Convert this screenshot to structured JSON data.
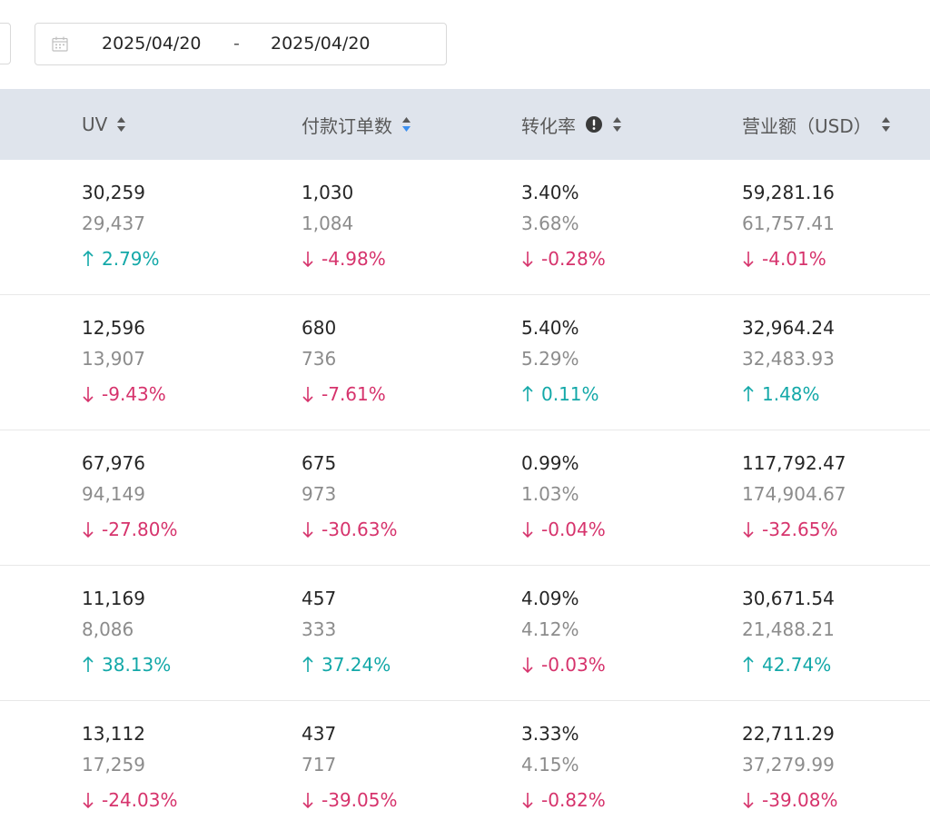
{
  "filters": {
    "date_start": "2025/04/20",
    "date_separator": "-",
    "date_end": "2025/04/20"
  },
  "columns": [
    {
      "key": "uv",
      "label": "UV",
      "sort": "none",
      "info": false
    },
    {
      "key": "orders",
      "label": "付款订单数",
      "sort": "descending",
      "info": false
    },
    {
      "key": "conversion",
      "label": "转化率",
      "sort": "none",
      "info": true
    },
    {
      "key": "revenue",
      "label": "营业额（USD）",
      "sort": "none",
      "info": false
    }
  ],
  "rows": [
    [
      {
        "current": "30,259",
        "previous": "29,437",
        "change": "2.79%",
        "direction": "up"
      },
      {
        "current": "1,030",
        "previous": "1,084",
        "change": "-4.98%",
        "direction": "down"
      },
      {
        "current": "3.40%",
        "previous": "3.68%",
        "change": "-0.28%",
        "direction": "down"
      },
      {
        "current": "59,281.16",
        "previous": "61,757.41",
        "change": "-4.01%",
        "direction": "down"
      }
    ],
    [
      {
        "current": "12,596",
        "previous": "13,907",
        "change": "-9.43%",
        "direction": "down"
      },
      {
        "current": "680",
        "previous": "736",
        "change": "-7.61%",
        "direction": "down"
      },
      {
        "current": "5.40%",
        "previous": "5.29%",
        "change": "0.11%",
        "direction": "up"
      },
      {
        "current": "32,964.24",
        "previous": "32,483.93",
        "change": "1.48%",
        "direction": "up"
      }
    ],
    [
      {
        "current": "67,976",
        "previous": "94,149",
        "change": "-27.80%",
        "direction": "down"
      },
      {
        "current": "675",
        "previous": "973",
        "change": "-30.63%",
        "direction": "down"
      },
      {
        "current": "0.99%",
        "previous": "1.03%",
        "change": "-0.04%",
        "direction": "down"
      },
      {
        "current": "117,792.47",
        "previous": "174,904.67",
        "change": "-32.65%",
        "direction": "down"
      }
    ],
    [
      {
        "current": "11,169",
        "previous": "8,086",
        "change": "38.13%",
        "direction": "up"
      },
      {
        "current": "457",
        "previous": "333",
        "change": "37.24%",
        "direction": "up"
      },
      {
        "current": "4.09%",
        "previous": "4.12%",
        "change": "-0.03%",
        "direction": "down"
      },
      {
        "current": "30,671.54",
        "previous": "21,488.21",
        "change": "42.74%",
        "direction": "up"
      }
    ],
    [
      {
        "current": "13,112",
        "previous": "17,259",
        "change": "-24.03%",
        "direction": "down"
      },
      {
        "current": "437",
        "previous": "717",
        "change": "-39.05%",
        "direction": "down"
      },
      {
        "current": "3.33%",
        "previous": "4.15%",
        "change": "-0.82%",
        "direction": "down"
      },
      {
        "current": "22,711.29",
        "previous": "37,279.99",
        "change": "-39.08%",
        "direction": "down"
      }
    ]
  ],
  "colors": {
    "up": "#13a8a8",
    "down": "#d6336c",
    "sort_active": "#3b8ff0",
    "sort_inactive": "#595959",
    "header_bg": "#dfe4ec"
  }
}
